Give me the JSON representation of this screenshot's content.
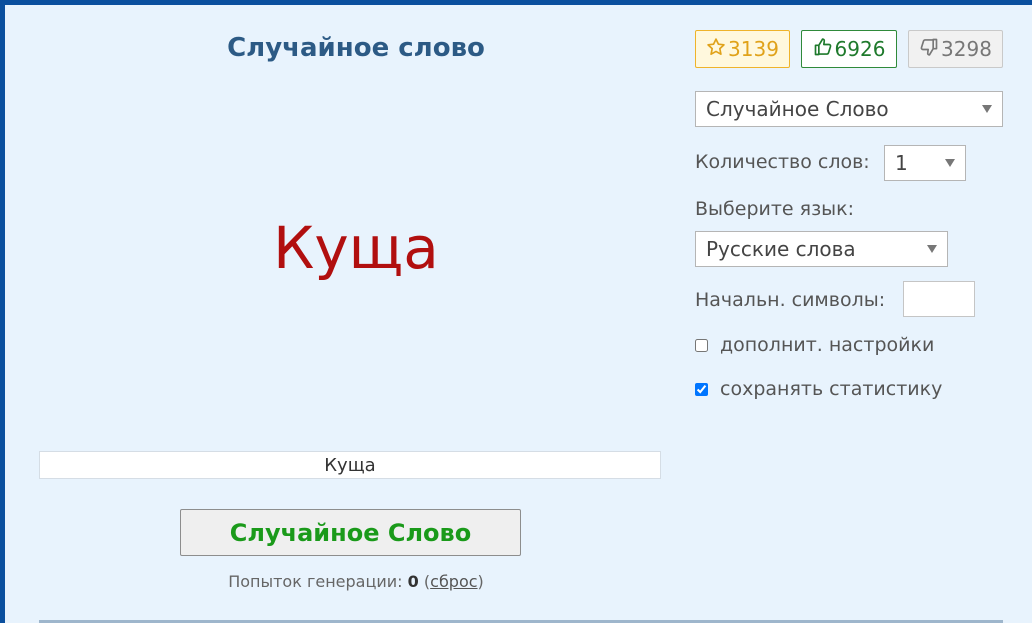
{
  "main": {
    "title": "Случайное слово",
    "current_word": "Куща",
    "word_field_value": "Куща",
    "generate_button": "Случайное Слово",
    "attempts": {
      "label": "Попыток генерации:",
      "count": "0",
      "reset_open": "(",
      "reset": "сброс",
      "reset_close": ")"
    }
  },
  "counters": {
    "favorites": "3139",
    "likes": "6926",
    "dislikes": "3298"
  },
  "settings": {
    "mode_selected": "Случайное Слово",
    "word_count_label": "Количество слов:",
    "word_count_selected": "1",
    "language_label": "Выберите язык:",
    "language_selected": "Русские слова",
    "start_symbols_label": "Начальн. символы:",
    "start_symbols_value": "",
    "advanced_label": "дополнит. настройки",
    "advanced_checked": false,
    "save_stats_label": "сохранять статистику",
    "save_stats_checked": true
  },
  "colors": {
    "frame_border": "#0a4f9e",
    "background": "#e8f3fd",
    "title": "#2c5a85",
    "word": "#b10f0f",
    "button_text": "#1a9a1a"
  },
  "icons": {
    "favorites": "star-outline-icon",
    "likes": "thumbs-up-icon",
    "dislikes": "thumbs-down-icon",
    "select": "caret-down-icon"
  }
}
